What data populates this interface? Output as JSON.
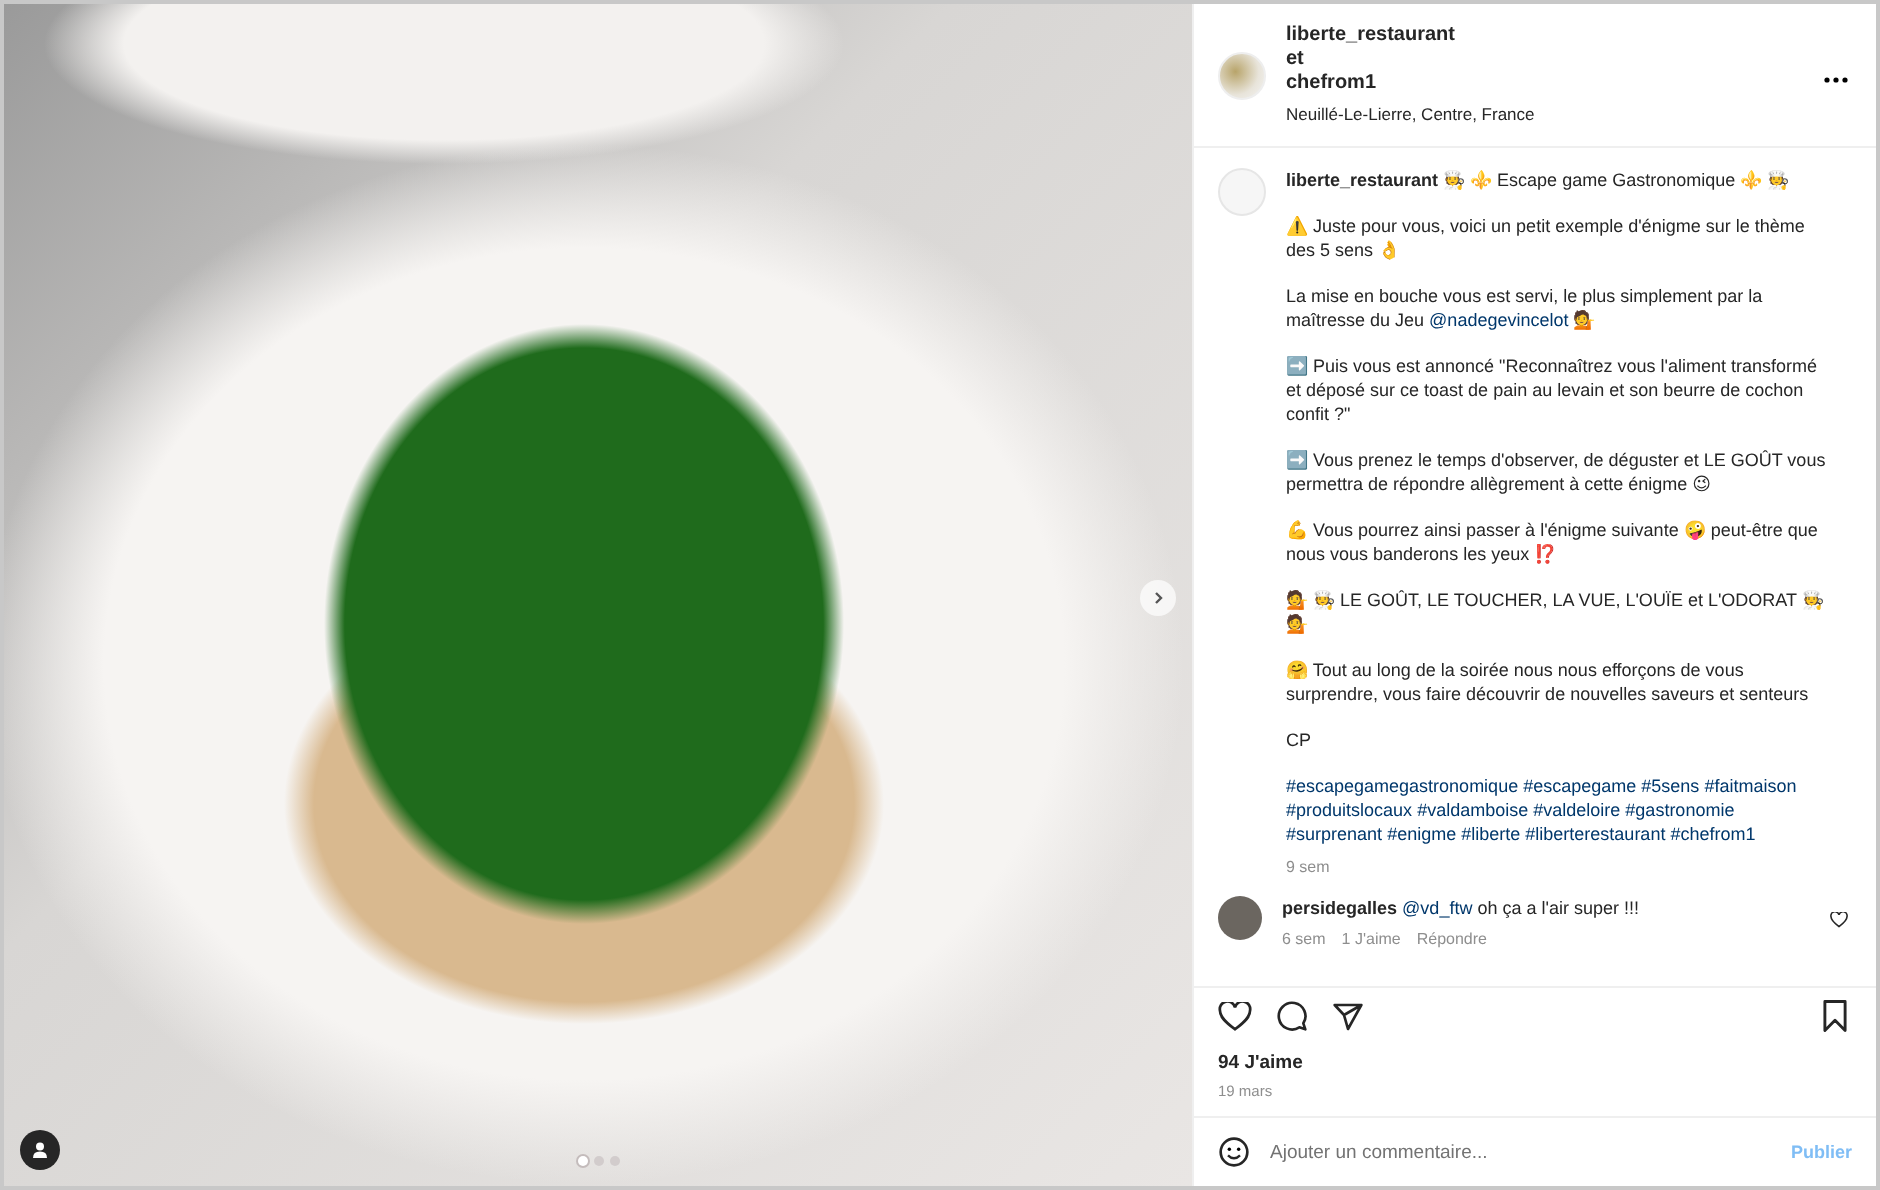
{
  "media": {
    "carousel_dots": [
      {
        "selected": true
      },
      {
        "selected": false
      },
      {
        "selected": false
      }
    ]
  },
  "header": {
    "owners": [
      "liberte_restaurant",
      "et",
      "chefrom1"
    ],
    "location": "Neuillé-Le-Lierre, Centre, France"
  },
  "caption": {
    "username": "liberte_restaurant",
    "title": "🧑‍🍳 ⚜️ Escape game Gastronomique ⚜️ 🧑‍🍳",
    "paragraphs": [
      [
        {
          "kind": "text",
          "text": "⚠️ Juste pour vous, voici un petit exemple d'énigme sur le thème des 5 sens 👌"
        }
      ],
      [
        {
          "kind": "text",
          "text": "La mise en bouche vous est servi, le plus simplement par la maîtresse du Jeu "
        },
        {
          "kind": "link",
          "text": "@nadegevincelot"
        },
        {
          "kind": "text",
          "text": " 💁"
        }
      ],
      [
        {
          "kind": "text",
          "text": "➡️ Puis vous est annoncé \"Reconnaîtrez vous l'aliment transformé et déposé sur ce toast de pain au levain et son beurre de cochon confit ?\""
        }
      ],
      [
        {
          "kind": "text",
          "text": "➡️ Vous prenez le temps d'observer, de déguster et LE GOÛT vous permettra de répondre allègrement à cette énigme 😉"
        }
      ],
      [
        {
          "kind": "text",
          "text": "💪 Vous pourrez ainsi passer à l'énigme suivante 🤪 peut-être que nous vous banderons les yeux ⁉️"
        }
      ],
      [
        {
          "kind": "text",
          "text": "💁 🧑‍🍳 LE GOÛT, LE TOUCHER, LA VUE, L'OUÏE et L'ODORAT 🧑‍🍳 💁"
        }
      ],
      [
        {
          "kind": "text",
          "text": "🤗 Tout au long de la soirée nous nous efforçons de vous surprendre, vous faire découvrir de nouvelles saveurs et senteurs"
        }
      ],
      [
        {
          "kind": "text",
          "text": "CP"
        }
      ]
    ],
    "hashtags": [
      "#escapegamegastronomique",
      "#escapegame",
      "#5sens",
      "#faitmaison",
      "#produitslocaux",
      "#valdamboise",
      "#valdeloire",
      "#gastronomie",
      "#surprenant",
      "#enigme",
      "#liberte",
      "#liberterestaurant",
      "#chefrom1"
    ],
    "age": "9 sem"
  },
  "comments": [
    {
      "username": "persidegalles",
      "mention": "@vd_ftw",
      "text": "oh ça a l'air super !!!",
      "age": "6 sem",
      "likes": "1 J'aime",
      "reply": "Répondre"
    }
  ],
  "likes": "94 J'aime",
  "date": "19 mars",
  "comment_box": {
    "placeholder": "Ajouter un commentaire...",
    "button": "Publier"
  }
}
